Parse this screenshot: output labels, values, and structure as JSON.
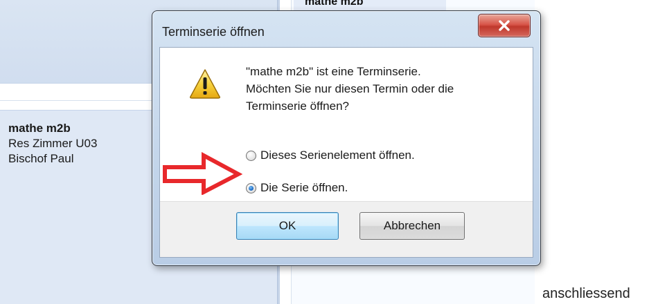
{
  "calendar": {
    "right_event_title": "mathe m2b",
    "appointment": {
      "title": "mathe m2b",
      "room": "Res Zimmer U03",
      "person": "Bischof Paul"
    }
  },
  "dialog": {
    "title": "Terminserie öffnen",
    "message_lines": [
      "\"mathe m2b\" ist eine Terminserie.",
      "Möchten Sie nur diesen Termin oder die",
      "Terminserie öffnen?"
    ],
    "options": [
      {
        "label": "Dieses Serienelement öffnen.",
        "selected": false
      },
      {
        "label": "Die Serie öffnen.",
        "selected": true
      }
    ],
    "ok_label": "OK",
    "cancel_label": "Abbrechen",
    "close_icon": "close-icon"
  },
  "annotation": {
    "arrow_color": "#e8282b",
    "trailing_text": "anschliessend"
  },
  "colors": {
    "accent": "#3c7fb1",
    "close_red": "#c0382c"
  }
}
